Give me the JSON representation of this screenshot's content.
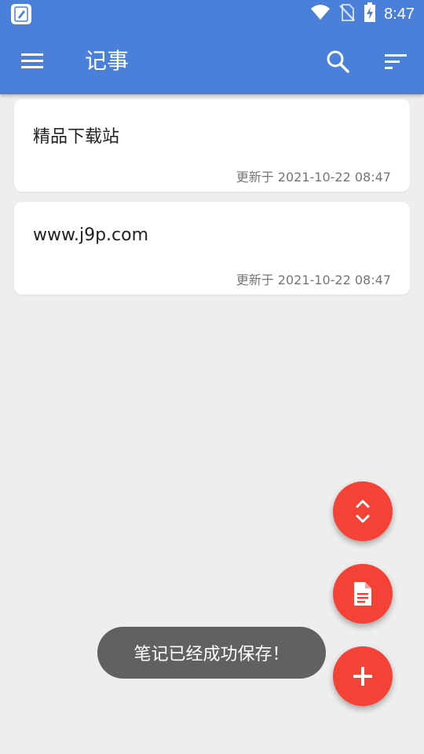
{
  "status_bar": {
    "time": "8:47",
    "icons": [
      "wifi-icon",
      "no-sim-icon",
      "battery-charging-icon"
    ]
  },
  "app_bar": {
    "title": "记事",
    "icons": [
      "menu-icon",
      "search-icon",
      "sort-icon"
    ]
  },
  "notes": [
    {
      "title": "精品下载站",
      "updated": "更新于 2021-10-22 08:47"
    },
    {
      "title": "www.j9p.com",
      "updated": "更新于 2021-10-22 08:47"
    }
  ],
  "fabs": [
    "expand-collapse-icon",
    "document-icon",
    "add-icon"
  ],
  "toast": {
    "message": "笔记已经成功保存！"
  },
  "colors": {
    "primary": "#4a80d9",
    "accent": "#f44336",
    "background": "#eeeeee",
    "toast": "#616161"
  }
}
